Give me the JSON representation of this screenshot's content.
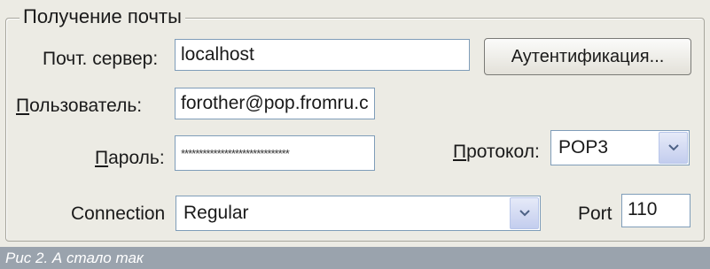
{
  "group_title": "Получение почты",
  "server": {
    "label": "Почт. сервер:",
    "value": "localhost"
  },
  "auth_button": "Аутентификация...",
  "user": {
    "label_u": "П",
    "label_rest": "ользователь:",
    "value": "forother@pop.fromru.c"
  },
  "password": {
    "label_u": "П",
    "label_rest": "ароль:",
    "value": "******************************"
  },
  "protocol": {
    "label_u": "П",
    "label_rest": "ротокол:",
    "value": "POP3"
  },
  "connection": {
    "label": "Connection",
    "value": "Regular"
  },
  "port": {
    "label": "Port",
    "value": "110"
  },
  "caption": "Рис 2. А стало так",
  "icons": {
    "dropdown": "chevron-down-icon"
  }
}
